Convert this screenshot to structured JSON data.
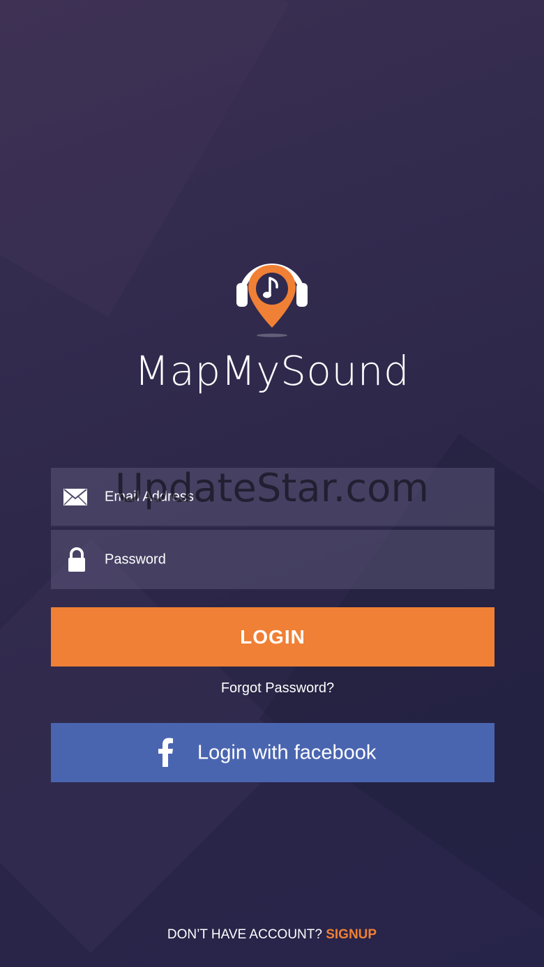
{
  "app": {
    "title": "MapMySound"
  },
  "form": {
    "email_placeholder": "Email Address",
    "password_placeholder": "Password",
    "login_label": "LOGIN",
    "forgot_label": "Forgot Password?",
    "facebook_label": "Login with facebook"
  },
  "footer": {
    "prompt": "DON’T HAVE ACCOUNT?",
    "signup_label": "SIGNUP"
  },
  "watermark": "UpdateStar.com",
  "icons": {
    "logo": "map-pin-headphones-icon",
    "email": "envelope-icon",
    "password": "lock-icon",
    "facebook": "facebook-icon"
  },
  "colors": {
    "accent": "#f08035",
    "facebook": "#4a65b0",
    "background": "#2f2a4e"
  }
}
